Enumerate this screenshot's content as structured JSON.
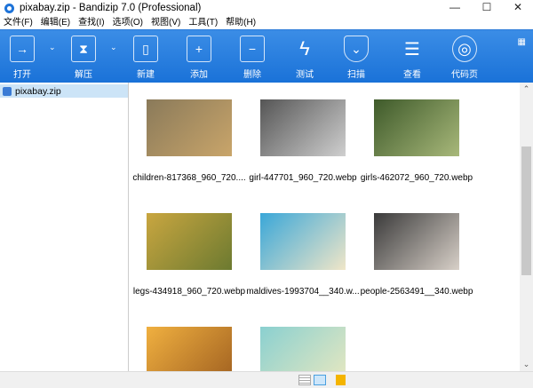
{
  "window": {
    "title": "pixabay.zip - Bandizip 7.0 (Professional)",
    "minimize": "—",
    "maximize": "☐",
    "close": "✕"
  },
  "menu": [
    "文件(F)",
    "编辑(E)",
    "查找(I)",
    "选项(O)",
    "视图(V)",
    "工具(T)",
    "帮助(H)"
  ],
  "toolbar": [
    {
      "label": "打开",
      "icon": "→"
    },
    {
      "label": "解压",
      "icon": "⧗"
    },
    {
      "label": "新建",
      "icon": "▯"
    },
    {
      "label": "添加",
      "icon": "+"
    },
    {
      "label": "删除",
      "icon": "−"
    },
    {
      "label": "测试",
      "icon": "ϟ"
    },
    {
      "label": "扫描",
      "icon": "⌄"
    },
    {
      "label": "查看",
      "icon": "☰"
    },
    {
      "label": "代码页",
      "icon": "◎"
    }
  ],
  "tree": {
    "archive": "pixabay.zip"
  },
  "files": [
    {
      "name": "children-817368_960_720....",
      "colors": [
        "#8a7a5a",
        "#c9a56a"
      ]
    },
    {
      "name": "girl-447701_960_720.webp",
      "colors": [
        "#555",
        "#cfcfcf"
      ]
    },
    {
      "name": "girls-462072_960_720.webp",
      "colors": [
        "#3e5a2a",
        "#a8b87a"
      ]
    },
    {
      "name": "legs-434918_960_720.webp",
      "colors": [
        "#c9a640",
        "#6c7a30"
      ]
    },
    {
      "name": "maldives-1993704__340.w...",
      "colors": [
        "#3aa7d8",
        "#f0e6c8"
      ]
    },
    {
      "name": "people-2563491__340.webp",
      "colors": [
        "#3a3a3a",
        "#d8d0c8"
      ]
    },
    {
      "name": "",
      "colors": [
        "#f0b040",
        "#a06020"
      ]
    },
    {
      "name": "",
      "colors": [
        "#8ad0d0",
        "#e8e8c0"
      ]
    }
  ]
}
